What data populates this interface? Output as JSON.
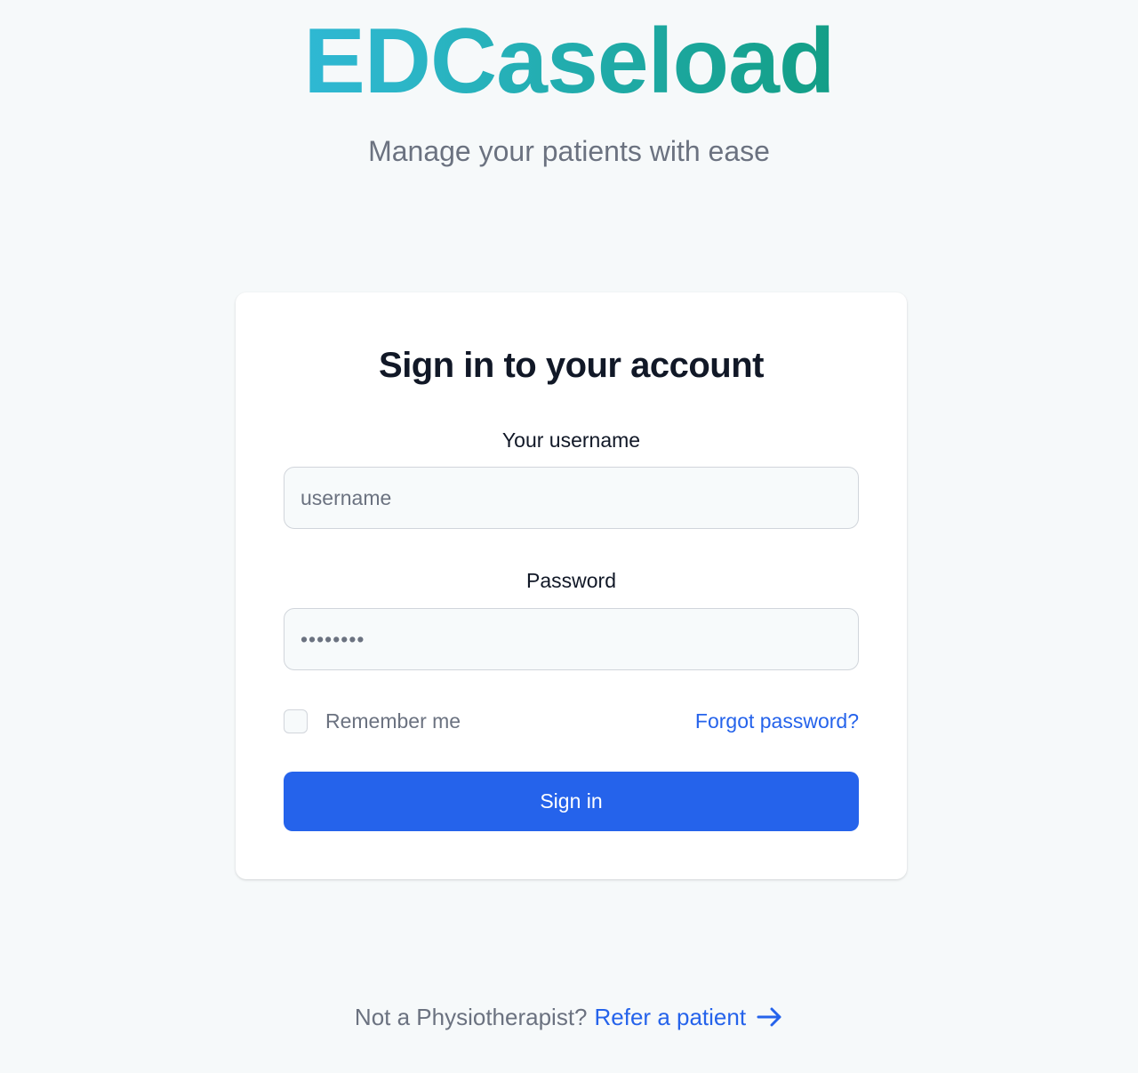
{
  "brand": {
    "name": "EDCaseload",
    "tagline": "Manage your patients with ease"
  },
  "login": {
    "title": "Sign in to your account",
    "username_label": "Your username",
    "username_placeholder": "username",
    "password_label": "Password",
    "password_placeholder": "••••••••",
    "remember_label": "Remember me",
    "forgot_label": "Forgot password?",
    "submit_label": "Sign in"
  },
  "footer": {
    "prompt": "Not a Physiotherapist?",
    "link_label": "Refer a patient",
    "link_icon": "arrow-right-icon"
  },
  "colors": {
    "accent": "#2563eb",
    "background": "#f6f9fa",
    "brand_gradient_start": "#38bdf8",
    "brand_gradient_end": "#0d8f6e"
  }
}
